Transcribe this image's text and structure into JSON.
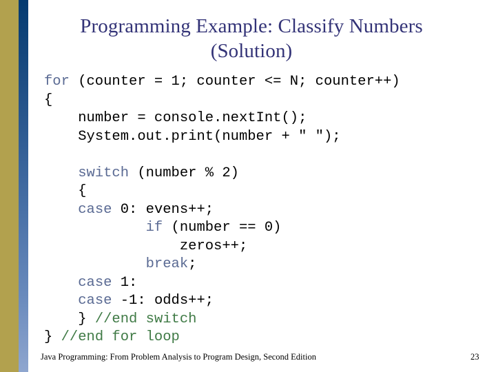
{
  "slide": {
    "title_lines": [
      "Programming Example: Classify Numbers",
      "(Solution)"
    ],
    "title_color": "#333377",
    "background_color": "#ffffff"
  },
  "decor": {
    "gold_band_color": "#b2a14e",
    "blue_band_top_color": "#033a70",
    "blue_band_bottom_color": "#8fa6cf"
  },
  "code": {
    "keyword_color": "#5a6a93",
    "comment_color": "#3f7a45",
    "text_color": "#000000",
    "lines": [
      {
        "indent": "",
        "segments": [
          {
            "t": "for",
            "c": "kw"
          },
          {
            "t": " (counter = 1; counter <= N; counter++)",
            "c": "plain"
          }
        ]
      },
      {
        "indent": "",
        "segments": [
          {
            "t": "{",
            "c": "plain"
          }
        ]
      },
      {
        "indent": "    ",
        "segments": [
          {
            "t": "number = console.nextInt();",
            "c": "plain"
          }
        ]
      },
      {
        "indent": "    ",
        "segments": [
          {
            "t": "System.out.print(number + \" \");",
            "c": "plain"
          }
        ]
      },
      {
        "indent": "",
        "segments": [
          {
            "t": "",
            "c": "plain"
          }
        ]
      },
      {
        "indent": "    ",
        "segments": [
          {
            "t": "switch",
            "c": "kw"
          },
          {
            "t": " (number % 2)",
            "c": "plain"
          }
        ]
      },
      {
        "indent": "    ",
        "segments": [
          {
            "t": "{",
            "c": "plain"
          }
        ]
      },
      {
        "indent": "    ",
        "segments": [
          {
            "t": "case",
            "c": "kw"
          },
          {
            "t": " 0: evens++;",
            "c": "plain"
          }
        ]
      },
      {
        "indent": "            ",
        "segments": [
          {
            "t": "if",
            "c": "kw"
          },
          {
            "t": " (number == 0)",
            "c": "plain"
          }
        ]
      },
      {
        "indent": "                ",
        "segments": [
          {
            "t": "zeros++;",
            "c": "plain"
          }
        ]
      },
      {
        "indent": "            ",
        "segments": [
          {
            "t": "break",
            "c": "kw"
          },
          {
            "t": ";",
            "c": "plain"
          }
        ]
      },
      {
        "indent": "    ",
        "segments": [
          {
            "t": "case",
            "c": "kw"
          },
          {
            "t": " 1:",
            "c": "plain"
          }
        ]
      },
      {
        "indent": "    ",
        "segments": [
          {
            "t": "case",
            "c": "kw"
          },
          {
            "t": " -1: odds++;",
            "c": "plain"
          }
        ]
      },
      {
        "indent": "    ",
        "segments": [
          {
            "t": "} ",
            "c": "plain"
          },
          {
            "t": "//end switch",
            "c": "cmt"
          }
        ]
      },
      {
        "indent": "",
        "segments": [
          {
            "t": "} ",
            "c": "plain"
          },
          {
            "t": "//end for loop",
            "c": "cmt"
          }
        ]
      }
    ]
  },
  "footer": {
    "text": "Java Programming: From Problem Analysis to Program Design, Second Edition",
    "page_number": "23"
  }
}
